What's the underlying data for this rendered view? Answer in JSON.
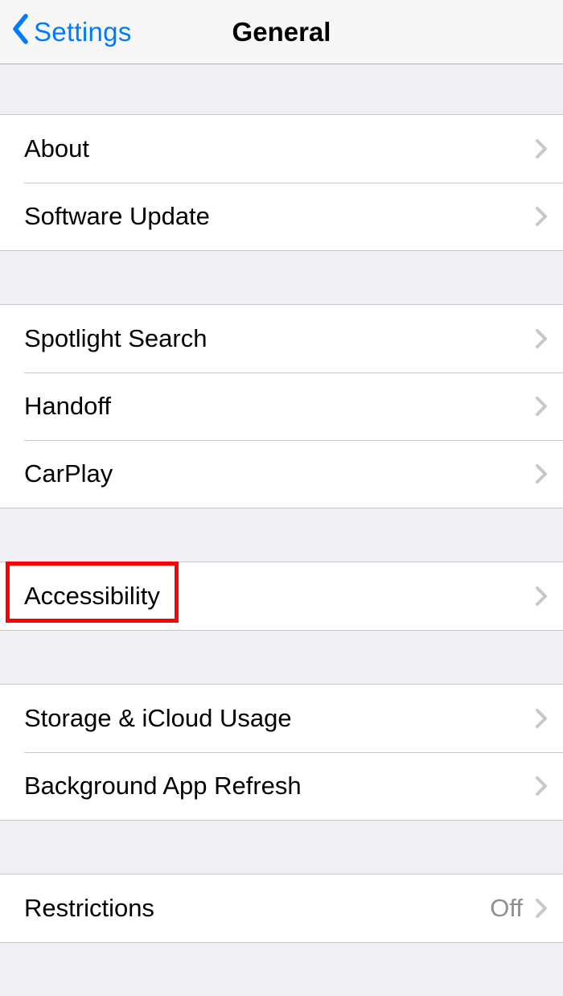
{
  "navbar": {
    "back_label": "Settings",
    "title": "General"
  },
  "groups": [
    {
      "rows": [
        {
          "id": "about",
          "label": "About"
        },
        {
          "id": "software-update",
          "label": "Software Update"
        }
      ]
    },
    {
      "rows": [
        {
          "id": "spotlight-search",
          "label": "Spotlight Search"
        },
        {
          "id": "handoff",
          "label": "Handoff"
        },
        {
          "id": "carplay",
          "label": "CarPlay"
        }
      ]
    },
    {
      "rows": [
        {
          "id": "accessibility",
          "label": "Accessibility"
        }
      ]
    },
    {
      "rows": [
        {
          "id": "storage-icloud",
          "label": "Storage & iCloud Usage"
        },
        {
          "id": "background-app-refresh",
          "label": "Background App Refresh"
        }
      ]
    },
    {
      "rows": [
        {
          "id": "restrictions",
          "label": "Restrictions",
          "value": "Off"
        }
      ]
    }
  ],
  "highlight": {
    "target_row_id": "accessibility"
  }
}
